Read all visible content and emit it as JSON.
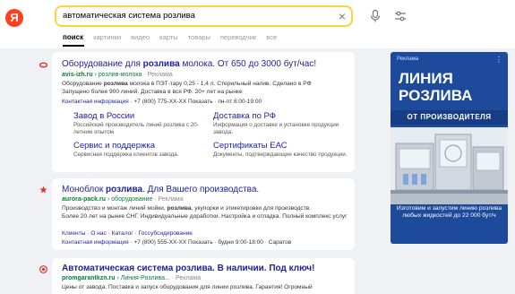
{
  "header": {
    "logo": "Я",
    "search_value": "автоматическая система розлива",
    "clear_icon": "×",
    "tabs": [
      "поиск",
      "картинки",
      "видео",
      "карты",
      "товары",
      "переводчик",
      "все"
    ]
  },
  "results": [
    {
      "title_pre": "Оборудование для ",
      "title_bold": "розлива",
      "title_post": " молока. От 650 до 3000 бут/час!",
      "domain": "avis-izh.ru",
      "path": "› розлив-молока",
      "ad": "· Реклама",
      "snippet_line1_pre": "Оборудование ",
      "snippet_line1_bold": "розлива",
      "snippet_line1_post": " молока в ПЭТ-тару 0,25 - 1,4 л. Стерильный налив. Сделано в РФ",
      "snippet_line2": "Запущено более 900 линий. Доставка в вся РФ. 20+ лет на рынке",
      "contact_link": "Контактная информация",
      "contact_rest": "· +7 (800) 775-XX-XX Показать · пн-пт 8:00-19:00",
      "sitelinks": [
        {
          "title": "Завод в России",
          "desc": "Российский производитель линий розлива с 20-летним опытом"
        },
        {
          "title": "Доставка по РФ",
          "desc": "Информация о доставке и установке продукции завода."
        },
        {
          "title": "Сервис и поддержка",
          "desc": "Сервисная поддержка клиентов завода."
        },
        {
          "title": "Сертификаты ЕАС",
          "desc": "Документы, подтверждающие качество продукции."
        }
      ]
    },
    {
      "title_pre": "Моноблок ",
      "title_bold": "розлива",
      "title_post": ". Для Вашего производства.",
      "domain": "aurora-pack.ru",
      "path": "› оборудование",
      "ad": "· Реклама",
      "snippet_line1_pre": "Производство и монтаж линий мойки, ",
      "snippet_line1_bold": "розлива",
      "snippet_line1_post": ", укупорки и этикетировки для производств.",
      "snippet_line2": "Более 20 лет на рынке СНГ. Индивидуальные доработки. Настройка и отладка. Полный комплекс услуг",
      "links": "Клиенты · О нас · Каталог · Госсубсидирование",
      "contact_link": "Контактная информация",
      "contact_rest": "· +7 (800) 555-XX-XX Показать · будни 9:00-18:00 · Саратов"
    },
    {
      "title_pre": "Автоматическая система ",
      "title_bold": "розлива",
      "title_post": ". В наличии. Под ключ!",
      "domain": "promgarantkzn.ru",
      "path": "› Линия-Розлива...",
      "ad": "· Реклама",
      "snippet": "Цены от завода. Поставка и запуск оборудования для линии розлива. Гарантия! Огромный"
    }
  ],
  "banner": {
    "label": "Реклама",
    "menu": "⋮",
    "title_line1": "ЛИНИЯ",
    "title_line2": "РОЗЛИВА",
    "subtitle": "ОТ ПРОИЗВОДИТЕЛЯ",
    "body": "Изготовим и запустим линию розлива любых жидкостей до 22 000 бут/ч",
    "bg_color": "#1e4a9b"
  }
}
